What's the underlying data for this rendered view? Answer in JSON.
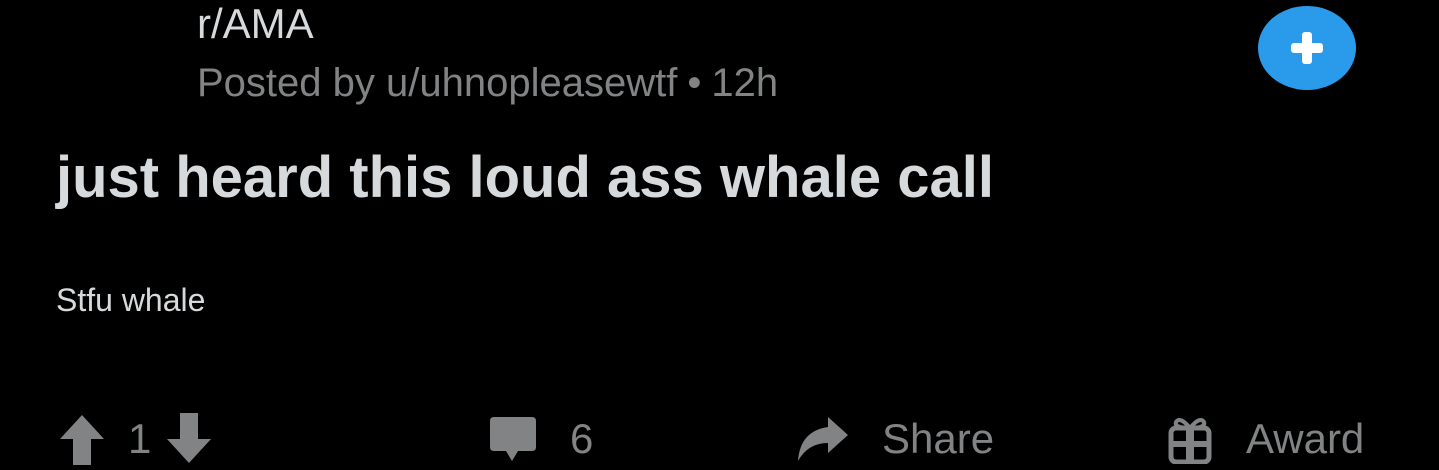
{
  "post": {
    "subreddit": "r/AMA",
    "posted_by_prefix": "Posted by",
    "author": "u/uhnopleasewtf",
    "separator": "•",
    "age": "12h",
    "title": "just heard this loud ass whale call",
    "body": "Stfu whale"
  },
  "join_button": {
    "icon": "plus-icon",
    "color": "#2a9bea"
  },
  "actions": {
    "upvote_icon": "arrow-up-icon",
    "score": "1",
    "downvote_icon": "arrow-down-icon",
    "comment_icon": "comment-bubble-icon",
    "comments": "6",
    "share_icon": "share-arrow-icon",
    "share_label": "Share",
    "award_icon": "gift-icon",
    "award_label": "Award"
  },
  "colors": {
    "background": "#000000",
    "text": "#d7dadc",
    "muted": "#818384",
    "accent": "#2a9bea"
  }
}
